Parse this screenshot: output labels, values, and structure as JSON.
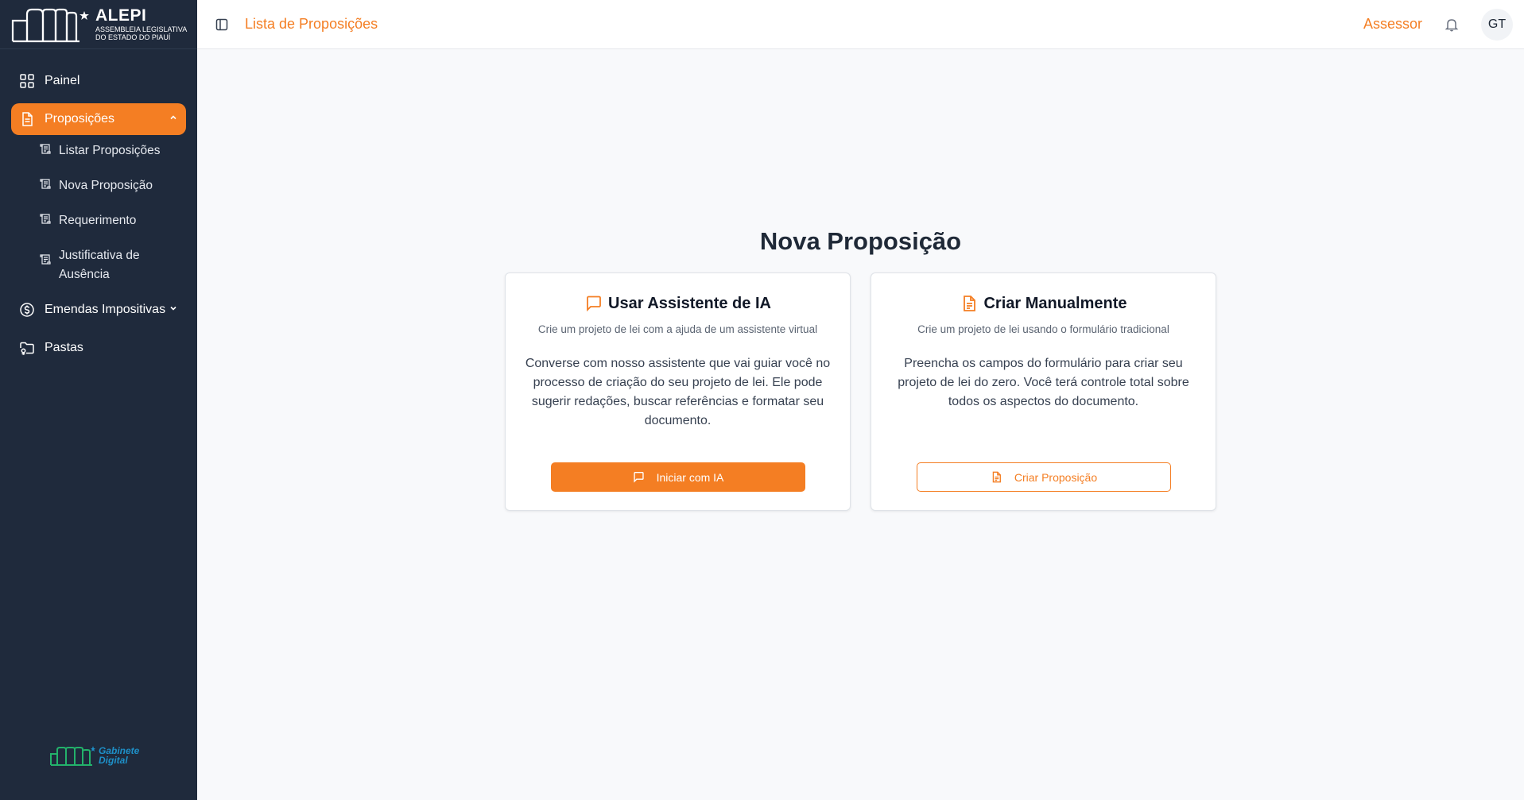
{
  "brand": {
    "title": "ALEPI",
    "subtitle_line1": "ASSEMBLEIA LEGISLATIVA",
    "subtitle_line2": "DO ESTADO DO PIAUÍ"
  },
  "sidebar": {
    "items": [
      {
        "label": "Painel",
        "icon": "grid-icon"
      },
      {
        "label": "Proposições",
        "icon": "document-icon",
        "active": true,
        "expanded": true
      },
      {
        "label": "Emendas Impositivas",
        "icon": "dollar-icon"
      },
      {
        "label": "Pastas",
        "icon": "folder-icon"
      }
    ],
    "subitems": [
      {
        "label": "Listar Proposições"
      },
      {
        "label": "Nova Proposição"
      },
      {
        "label": "Requerimento"
      },
      {
        "label": "Justificativa de Ausência"
      }
    ],
    "footer_logo_line1": "Gabinete",
    "footer_logo_line2": "Digital"
  },
  "topbar": {
    "breadcrumb": "Lista de Proposições",
    "role": "Assessor",
    "avatar_initials": "GT"
  },
  "main": {
    "title": "Nova Proposição",
    "cards": [
      {
        "title": "Usar Assistente de IA",
        "subtitle": "Crie um projeto de lei com a ajuda de um assistente virtual",
        "description": "Converse com nosso assistente que vai guiar você no processo de criação do seu projeto de lei. Ele pode sugerir redações, buscar referências e formatar seu documento.",
        "button": "Iniciar com IA"
      },
      {
        "title": "Criar Manualmente",
        "subtitle": "Crie um projeto de lei usando o formulário tradicional",
        "description": "Preencha os campos do formulário para criar seu projeto de lei do zero. Você terá controle total sobre todos os aspectos do documento.",
        "button": "Criar Proposição"
      }
    ]
  },
  "colors": {
    "accent": "#f47e23",
    "sidebar_bg": "#1f2a3c",
    "page_bg": "#f8f9fb"
  }
}
